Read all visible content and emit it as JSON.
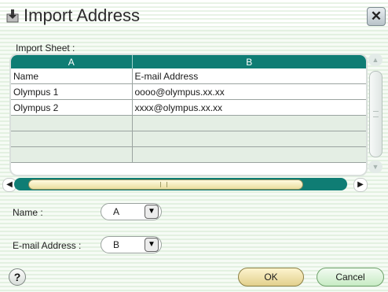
{
  "window": {
    "title": "Import Address",
    "close_glyph": "✕",
    "icon": "address-import-icon"
  },
  "sheet": {
    "label": "Import Sheet :",
    "columns": [
      "A",
      "B"
    ],
    "rows": [
      [
        "Name",
        "E-mail Address"
      ],
      [
        "Olympus 1",
        "oooo@olympus.xx.xx"
      ],
      [
        "Olympus 2",
        "xxxx@olympus.xx.xx"
      ],
      [
        "",
        ""
      ],
      [
        "",
        ""
      ],
      [
        "",
        ""
      ]
    ]
  },
  "scrollbars": {
    "up_glyph": "▲",
    "down_glyph": "▼",
    "left_glyph": "◀",
    "right_glyph": "▶",
    "horizontal_position": 0.0,
    "vertical_position": 0.0
  },
  "fields": {
    "name": {
      "label": "Name :",
      "value": "A",
      "dropdown_glyph": "▼"
    },
    "email": {
      "label": "E-mail Address :",
      "value": "B",
      "dropdown_glyph": "▼"
    }
  },
  "buttons": {
    "help": "?",
    "ok": "OK",
    "cancel": "Cancel"
  },
  "colors": {
    "accent": "#0f7d74",
    "ok_button": "#f1e4ad",
    "cancel_button": "#d6f0d3"
  }
}
